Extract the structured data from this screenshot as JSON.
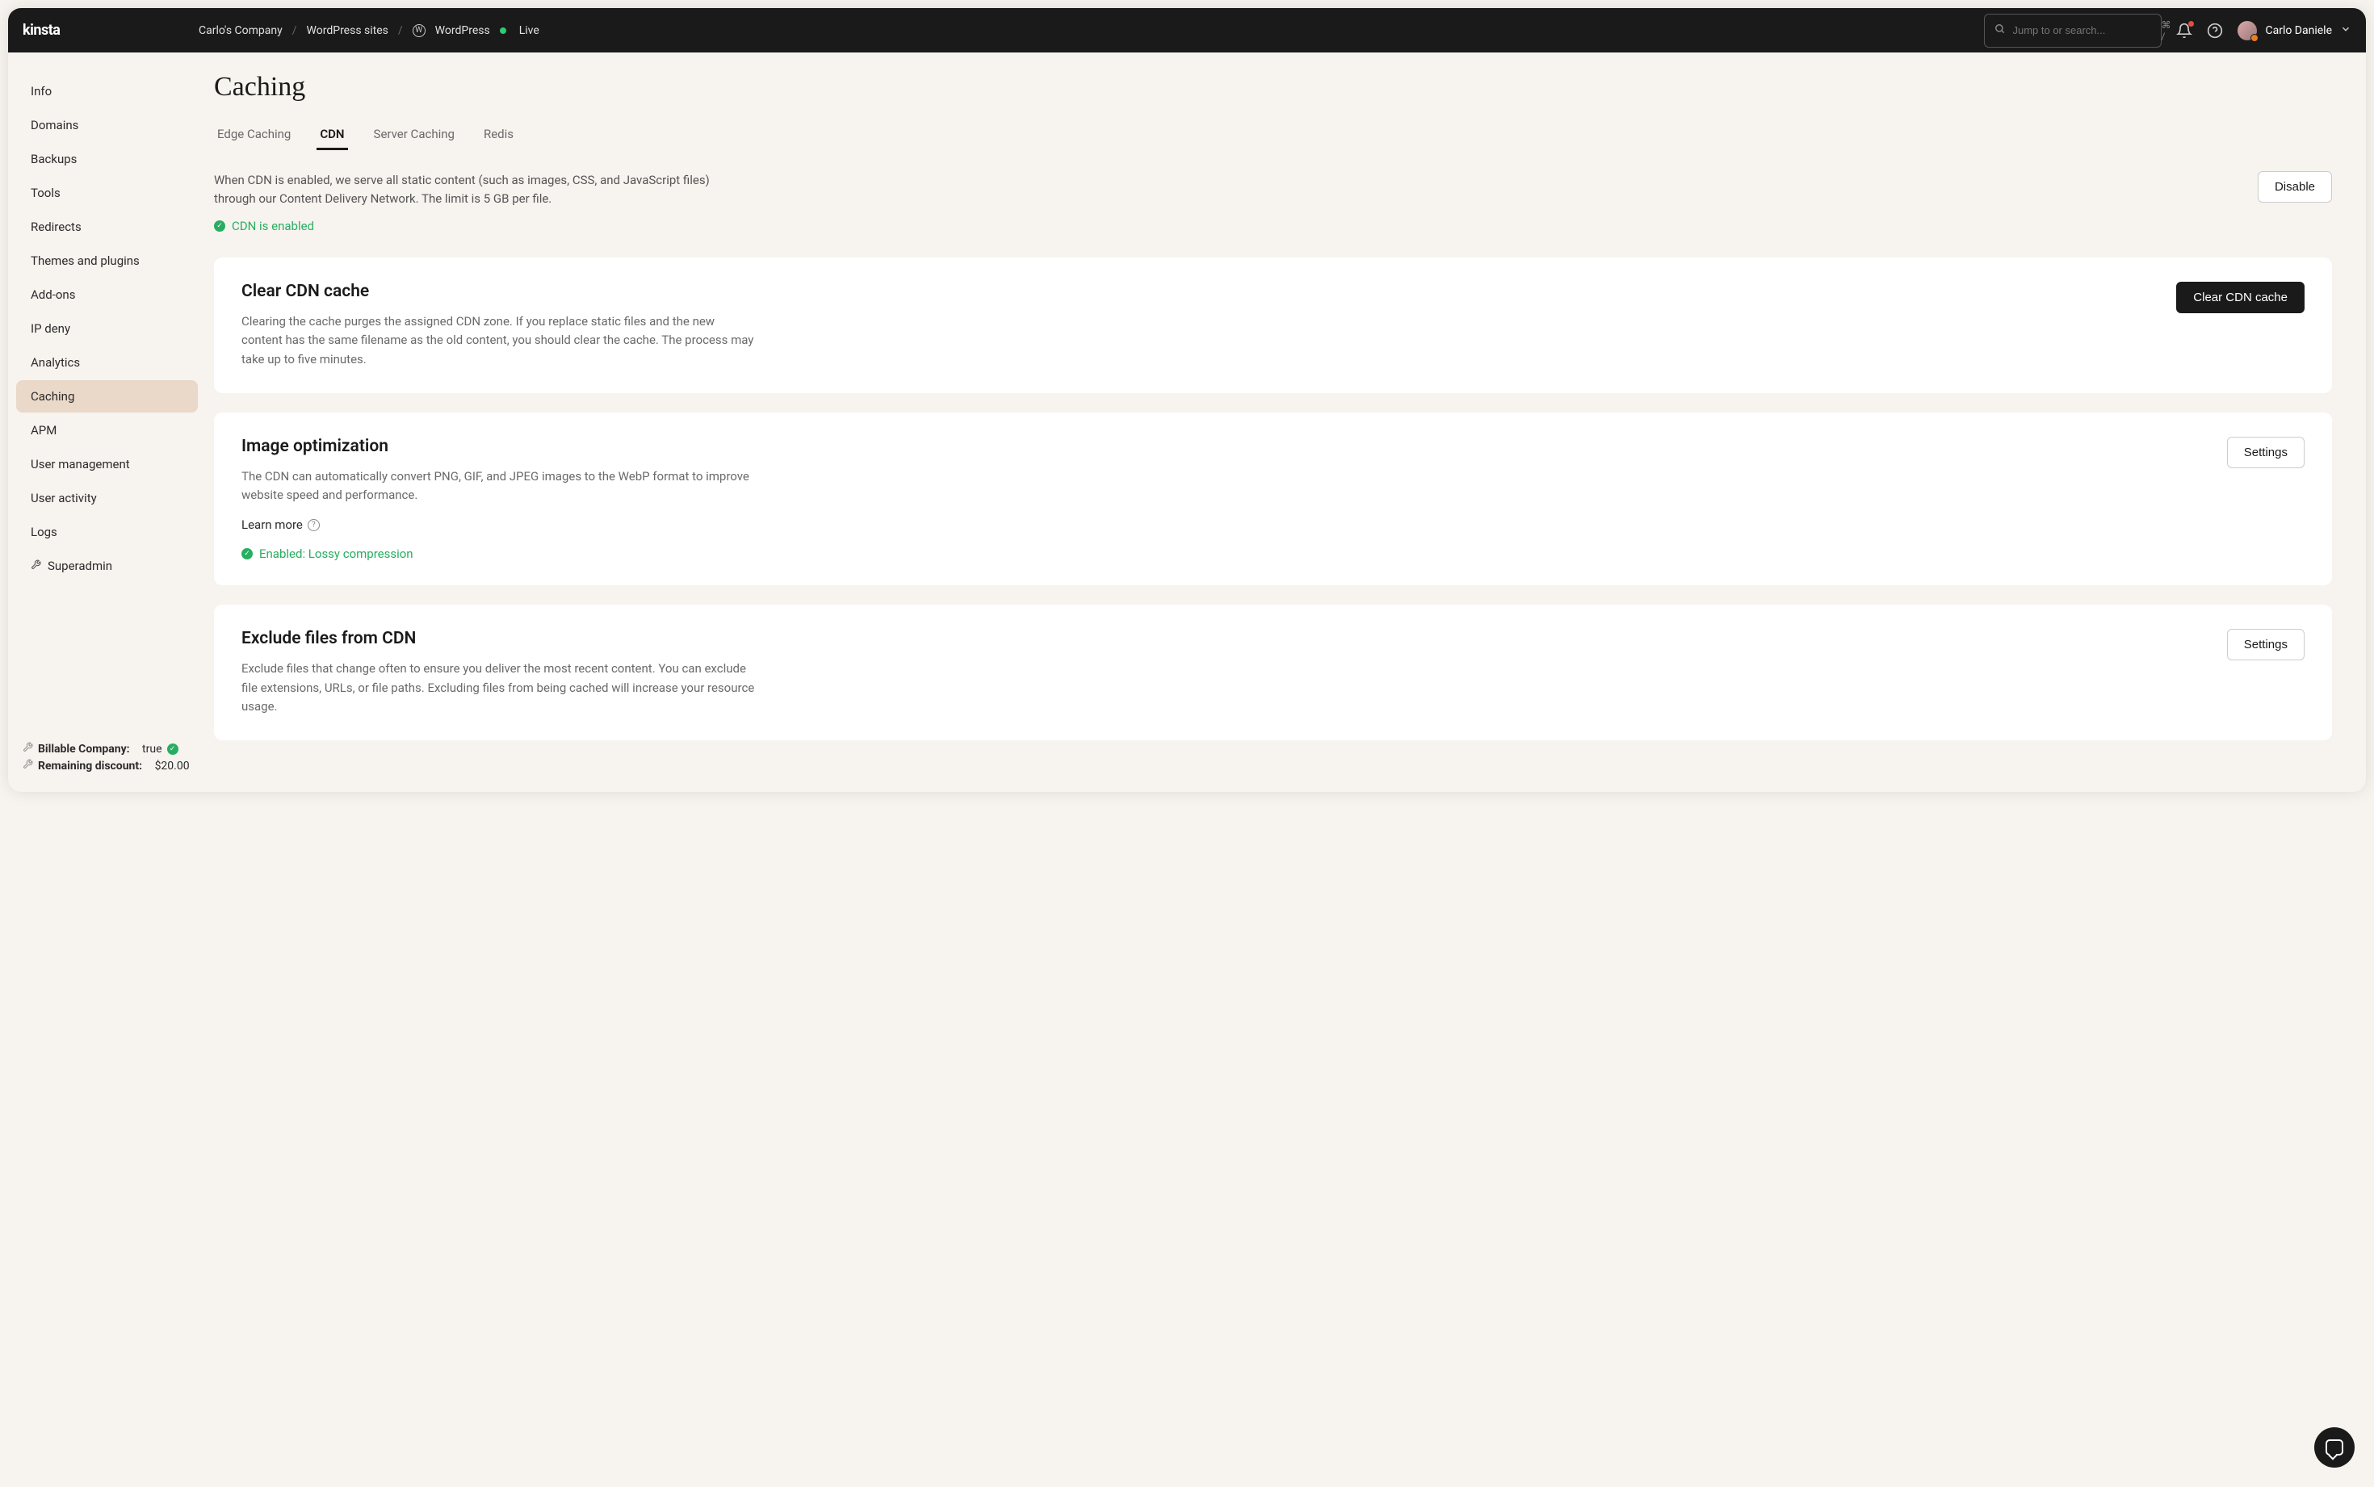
{
  "header": {
    "logo": "kinsta",
    "breadcrumbs": {
      "company": "Carlo's Company",
      "section": "WordPress sites",
      "site": "WordPress",
      "env": "Live"
    },
    "search": {
      "placeholder": "Jump to or search...",
      "shortcut": "⌘ /"
    },
    "user": {
      "name": "Carlo Daniele"
    }
  },
  "sidebar": {
    "items": [
      "Info",
      "Domains",
      "Backups",
      "Tools",
      "Redirects",
      "Themes and plugins",
      "Add-ons",
      "IP deny",
      "Analytics",
      "Caching",
      "APM",
      "User management",
      "User activity",
      "Logs",
      "Superadmin"
    ],
    "active": "Caching",
    "footer": {
      "billable_label": "Billable Company:",
      "billable_value": "true",
      "discount_label": "Remaining discount:",
      "discount_value": "$20.00"
    }
  },
  "page": {
    "title": "Caching",
    "tabs": [
      "Edge Caching",
      "CDN",
      "Server Caching",
      "Redis"
    ],
    "active_tab": "CDN",
    "intro": {
      "text": "When CDN is enabled, we serve all static content (such as images, CSS, and JavaScript files) through our Content Delivery Network. The limit is 5 GB per file.",
      "status": "CDN is enabled",
      "action": "Disable"
    },
    "cards": [
      {
        "title": "Clear CDN cache",
        "desc": "Clearing the cache purges the assigned CDN zone. If you replace static files and the new content has the same filename as the old content, you should clear the cache. The process may take up to five minutes.",
        "button": "Clear CDN cache",
        "button_style": "dark"
      },
      {
        "title": "Image optimization",
        "desc": "The CDN can automatically convert PNG, GIF, and JPEG images to the WebP format to improve website speed and performance.",
        "learn_more": "Learn more",
        "status": "Enabled: Lossy compression",
        "button": "Settings",
        "button_style": "light"
      },
      {
        "title": "Exclude files from CDN",
        "desc": "Exclude files that change often to ensure you deliver the most recent content. You can exclude file extensions, URLs, or file paths. Excluding files from being cached will increase your resource usage.",
        "button": "Settings",
        "button_style": "light"
      }
    ]
  }
}
